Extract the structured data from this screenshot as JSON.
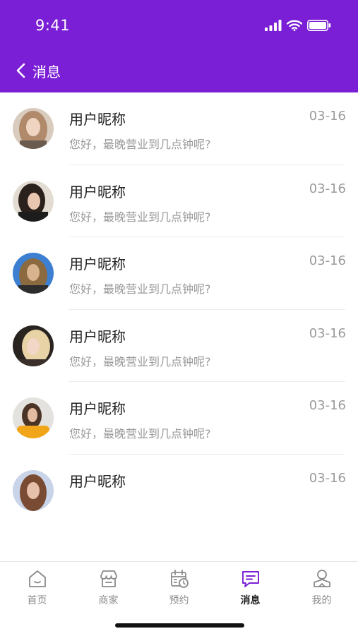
{
  "status_bar": {
    "time": "9:41"
  },
  "nav": {
    "title": "消息"
  },
  "messages": [
    {
      "name": "用户昵称",
      "date": "03-16",
      "text": "您好，最晚营业到几点钟呢?"
    },
    {
      "name": "用户昵称",
      "date": "03-16",
      "text": "您好，最晚营业到几点钟呢?"
    },
    {
      "name": "用户昵称",
      "date": "03-16",
      "text": "您好，最晚营业到几点钟呢?"
    },
    {
      "name": "用户昵称",
      "date": "03-16",
      "text": "您好，最晚营业到几点钟呢?"
    },
    {
      "name": "用户昵称",
      "date": "03-16",
      "text": "您好，最晚营业到几点钟呢?"
    },
    {
      "name": "用户昵称",
      "date": "03-16",
      "text": ""
    }
  ],
  "tabbar": {
    "items": [
      {
        "label": "首页",
        "icon": "home-icon",
        "active": false
      },
      {
        "label": "商家",
        "icon": "store-icon",
        "active": false
      },
      {
        "label": "预约",
        "icon": "calendar-clock-icon",
        "active": false
      },
      {
        "label": "消息",
        "icon": "message-icon",
        "active": true
      },
      {
        "label": "我的",
        "icon": "profile-icon",
        "active": false
      }
    ]
  },
  "colors": {
    "brand": "#7b1fd6",
    "text_primary": "#222222",
    "text_secondary": "#9a9a9a",
    "divider": "#ececec"
  }
}
